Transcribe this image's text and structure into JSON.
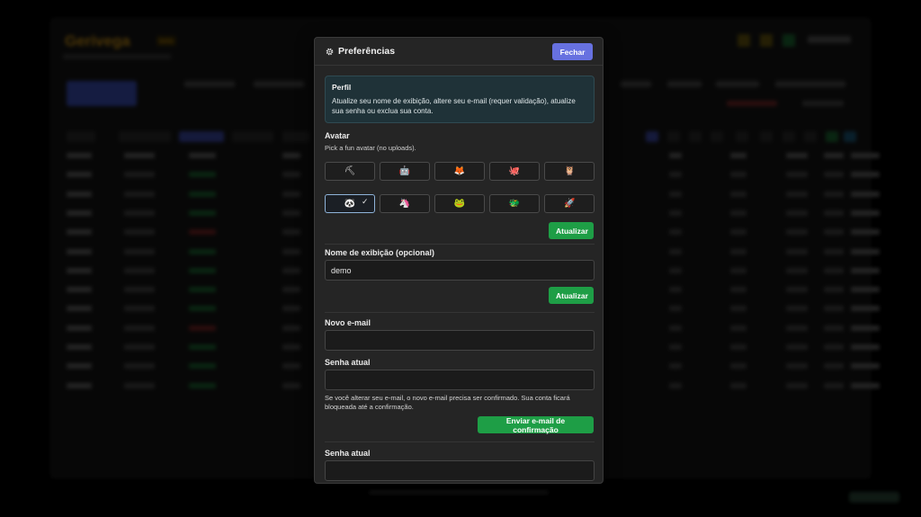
{
  "background": {
    "brand": "Gerivega",
    "brand_tag": "beta"
  },
  "modal": {
    "title": "Preferências",
    "icon": "gear-icon",
    "close_label": "Fechar",
    "profile_info": {
      "title": "Perfil",
      "text": "Atualize seu nome de exibição, altere seu e-mail (requer validação), atualize sua senha ou exclua sua conta."
    },
    "avatar": {
      "label": "Avatar",
      "hint": "Pick a fun avatar (no uploads).",
      "options": [
        "⛏",
        "🤖",
        "🦊",
        "🐙",
        "🦉",
        "🐼",
        "🦄",
        "🐸",
        "🐲",
        "🚀"
      ],
      "selected_index": 5,
      "update_label": "Atualizar"
    },
    "display_name": {
      "label": "Nome de exibição (opcional)",
      "value": "demo",
      "update_label": "Atualizar"
    },
    "email": {
      "label": "Novo e-mail",
      "value": "",
      "password_label": "Senha atual",
      "password_value": "",
      "note": "Se você alterar seu e-mail, o novo e-mail precisa ser confirmado. Sua conta ficará bloqueada até a confirmação.",
      "send_label": "Enviar e-mail de confirmação"
    },
    "password": {
      "label": "Senha atual",
      "value": ""
    }
  },
  "colors": {
    "accent": "#6771e0",
    "success": "#1e9e46",
    "info_bg": "#1f3238"
  }
}
